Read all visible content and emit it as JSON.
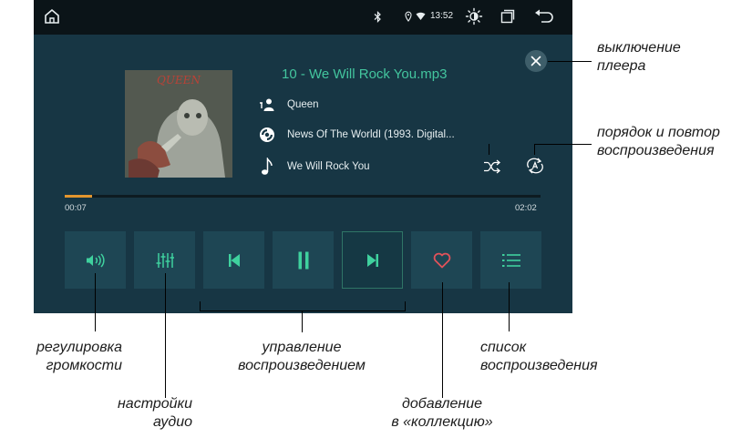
{
  "status_bar": {
    "time": "13:52",
    "icons": [
      "home-icon",
      "bluetooth-icon",
      "location-icon",
      "wifi-icon",
      "brightness-icon",
      "recent-apps-icon",
      "back-icon"
    ]
  },
  "player": {
    "title": "10 - We Will Rock You.mp3",
    "artist": "Queen",
    "album": "News Of The WorldI (1993. Digital...",
    "song": "We Will Rock You",
    "album_art_text": "QUEEN",
    "time_elapsed": "00:07",
    "time_total": "02:02",
    "progress_fraction": 0.058,
    "controls": [
      "volume-icon",
      "equalizer-icon",
      "previous-icon",
      "pause-icon",
      "next-icon",
      "heart-icon",
      "playlist-icon"
    ]
  },
  "colors": {
    "accent": "#43c59e",
    "progress": "#e3962e",
    "favorite": "#e0525a",
    "panel": "#173644",
    "button": "#1e4654"
  },
  "annotations": {
    "power_off": [
      "выключение",
      "плеера"
    ],
    "play_order": [
      "порядок и повтор",
      "воспроизведения"
    ],
    "volume": [
      "регулировка",
      "громкости"
    ],
    "audio_settings": [
      "настройки",
      "аудио"
    ],
    "playback_control": [
      "управление",
      "воспроизведением"
    ],
    "add_collection": [
      "добавление",
      "в «коллекцию»"
    ],
    "playlist": [
      "список",
      "воспроизведения"
    ]
  }
}
